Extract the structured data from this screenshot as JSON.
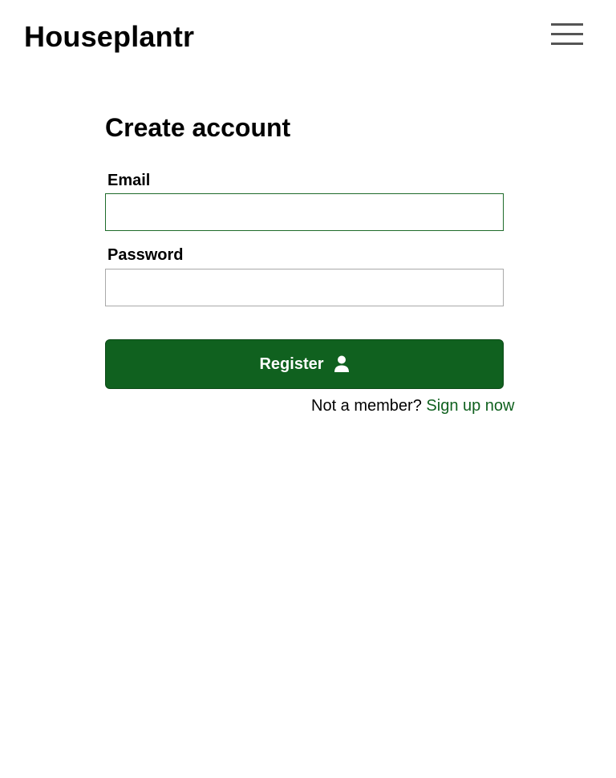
{
  "header": {
    "brand": "Houseplantr",
    "menu_icon": "hamburger-menu-icon"
  },
  "form": {
    "title": "Create account",
    "email": {
      "label": "Email",
      "value": "",
      "placeholder": ""
    },
    "password": {
      "label": "Password",
      "value": "",
      "placeholder": ""
    },
    "submit": {
      "label": "Register",
      "icon": "user-icon"
    },
    "footer": {
      "prompt": "Not a member?",
      "link_label": "Sign up now"
    }
  },
  "colors": {
    "primary": "#10611f",
    "link": "#10611f",
    "menu_bars": "#555555",
    "input_border": "#a9a9a9"
  }
}
